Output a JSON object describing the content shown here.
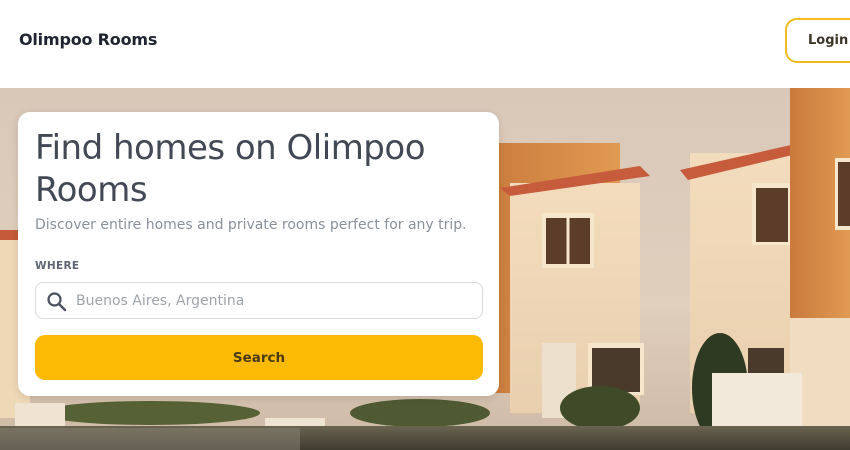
{
  "header": {
    "brand": "Olimpoo Rooms",
    "login_label": "Login"
  },
  "hero": {
    "title": "Find homes on Olimpoo Rooms",
    "subtitle": "Discover entire homes and private rooms perfect for any trip.",
    "where_label": "WHERE",
    "search": {
      "placeholder": "Buenos Aires, Argentina",
      "value": ""
    },
    "search_button": "Search",
    "image_subject": "row of modern townhouses at sunset"
  },
  "colors": {
    "accent": "#fcba04",
    "login_border": "#f5bb1c",
    "title_text": "#424955",
    "muted_text": "#8a909a"
  },
  "icons": {
    "search": "search-icon"
  }
}
